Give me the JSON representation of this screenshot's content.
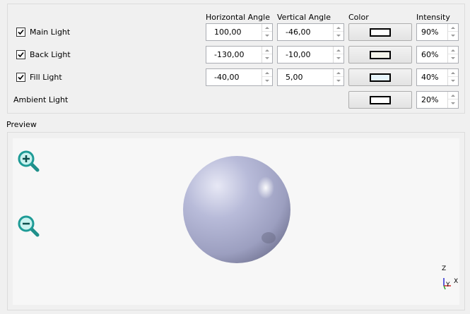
{
  "headers": {
    "horizontal_angle": "Horizontal Angle",
    "vertical_angle": "Vertical Angle",
    "color": "Color",
    "intensity": "Intensity"
  },
  "lights": [
    {
      "label": "Main Light",
      "checked": true,
      "horizontal": "100,00",
      "vertical": "-46,00",
      "color": "#ffffff",
      "intensity": "90%"
    },
    {
      "label": "Back Light",
      "checked": true,
      "horizontal": "-130,00",
      "vertical": "-10,00",
      "color": "#f3f3ea",
      "intensity": "60%"
    },
    {
      "label": "Fill Light",
      "checked": true,
      "horizontal": "-40,00",
      "vertical": "5,00",
      "color": "#e6f4fb",
      "intensity": "40%"
    }
  ],
  "ambient": {
    "label": "Ambient Light",
    "color": "#ffffff",
    "intensity": "20%"
  },
  "preview": {
    "label": "Preview",
    "zoom_in_icon": "zoom-in-icon",
    "zoom_out_icon": "zoom-out-icon",
    "sphere_color": "#b3b6d6",
    "axes": {
      "z": "Z",
      "y": "Y",
      "x": "X"
    }
  }
}
